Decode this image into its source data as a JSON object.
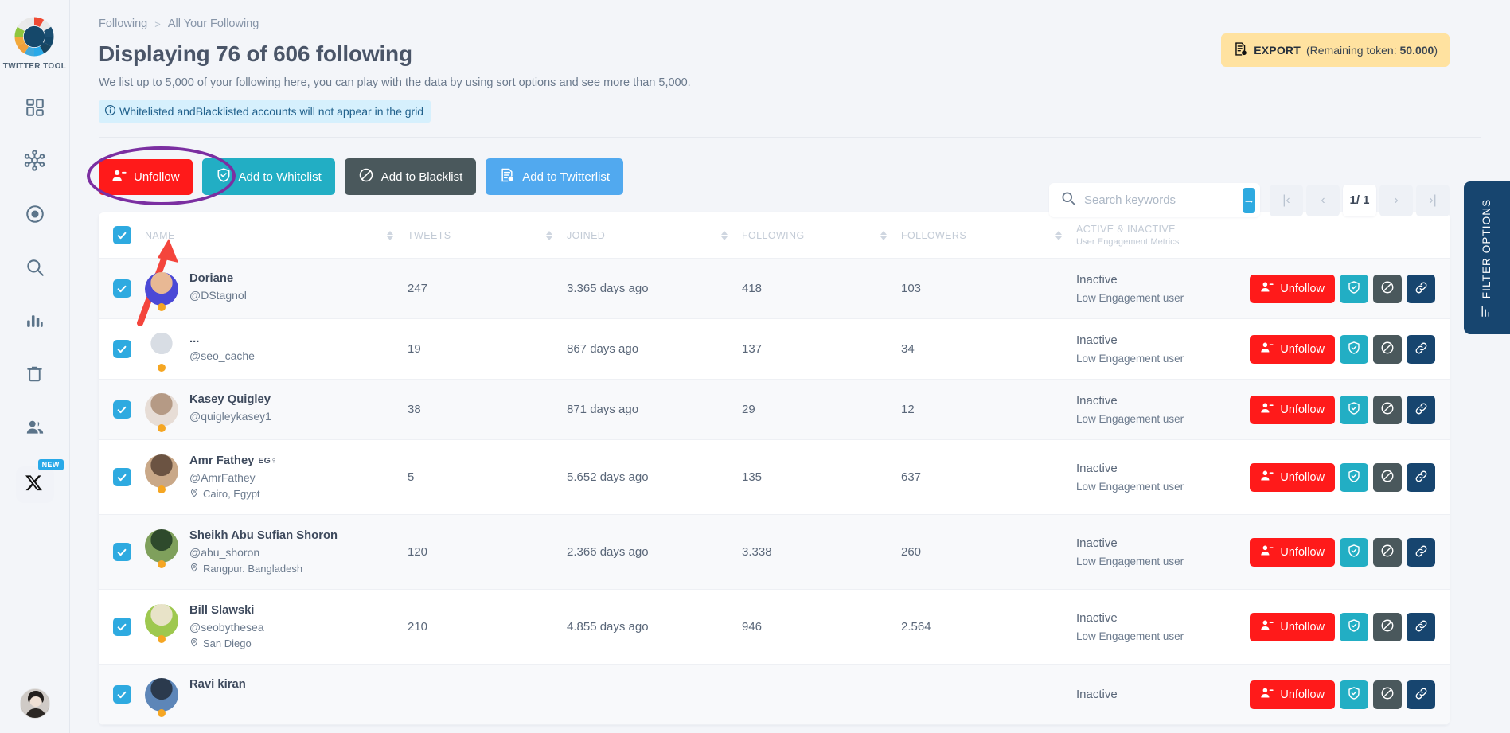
{
  "sidebar": {
    "brand": "TWITTER TOOL",
    "items": [
      {
        "name": "dashboard",
        "icon": "dashboard-icon"
      },
      {
        "name": "network",
        "icon": "network-icon"
      },
      {
        "name": "target",
        "icon": "target-icon"
      },
      {
        "name": "search",
        "icon": "search-icon"
      },
      {
        "name": "analytics",
        "icon": "analytics-icon"
      },
      {
        "name": "trash",
        "icon": "trash-icon"
      },
      {
        "name": "users",
        "icon": "users-icon"
      },
      {
        "name": "x",
        "icon": "x-icon",
        "badge": "NEW"
      }
    ]
  },
  "breadcrumb": {
    "root": "Following",
    "sep": ">",
    "current": "All Your Following"
  },
  "header": {
    "title": "Displaying 76 of 606 following",
    "subtitle": "We list up to 5,000 of your following here, you can play with the data by using sort options and see more than 5,000.",
    "info_banner": "Whitelisted andBlacklisted accounts will not appear in the grid"
  },
  "export": {
    "label": "EXPORT",
    "remaining_prefix": "(Remaining token: ",
    "remaining_value": "50.000",
    "remaining_suffix": ")"
  },
  "actions": {
    "unfollow": "Unfollow",
    "whitelist": "Add to Whitelist",
    "blacklist": "Add to Blacklist",
    "twitterlist": "Add to Twitterlist"
  },
  "search": {
    "placeholder": "Search keywords",
    "value": "",
    "go": "→"
  },
  "pagination": {
    "first": "|‹",
    "prev": "‹",
    "current": "1/ 1",
    "next": "›",
    "last": "›|"
  },
  "filter_tab": {
    "label": "FILTER OPTIONS"
  },
  "table": {
    "columns": [
      {
        "key": "name",
        "label": "NAME",
        "sortable": true
      },
      {
        "key": "tweets",
        "label": "TWEETS",
        "sortable": true
      },
      {
        "key": "joined",
        "label": "JOINED",
        "sortable": true
      },
      {
        "key": "following",
        "label": "FOLLOWING",
        "sortable": true
      },
      {
        "key": "followers",
        "label": "FOLLOWERS",
        "sortable": true
      },
      {
        "key": "active",
        "label": "ACTIVE & INACTIVE",
        "sublabel": "User Engagement Metrics",
        "sortable": false
      }
    ],
    "row_actions": {
      "unfollow": "Unfollow",
      "whitelist_icon": "shield-check-icon",
      "blacklist_icon": "block-icon",
      "link_icon": "link-icon"
    },
    "rows": [
      {
        "name": "Doriane",
        "handle": "@DStagnol",
        "location": "",
        "flag": "",
        "tweets": "247",
        "joined": "3.365 days ago",
        "following": "418",
        "followers": "103",
        "active": "Inactive",
        "engagement": "Low Engagement user",
        "checked": true,
        "avatar_colors": [
          "#4b49d6",
          "#e8b894"
        ]
      },
      {
        "name": "...",
        "handle": "@seo_cache",
        "location": "",
        "flag": "",
        "tweets": "19",
        "joined": "867 days ago",
        "following": "137",
        "followers": "34",
        "active": "Inactive",
        "engagement": "Low Engagement user",
        "checked": true,
        "avatar_colors": [
          "#ffffff",
          "#d8dde4"
        ]
      },
      {
        "name": "Kasey Quigley",
        "handle": "@quigleykasey1",
        "location": "",
        "flag": "",
        "tweets": "38",
        "joined": "871 days ago",
        "following": "29",
        "followers": "12",
        "active": "Inactive",
        "engagement": "Low Engagement user",
        "checked": true,
        "avatar_colors": [
          "#e7ddd6",
          "#b59a85"
        ]
      },
      {
        "name": "Amr Fathey",
        "handle": "@AmrFathey",
        "location": "Cairo, Egypt",
        "flag": "EG♀",
        "tweets": "5",
        "joined": "5.652 days ago",
        "following": "135",
        "followers": "637",
        "active": "Inactive",
        "engagement": "Low Engagement user",
        "checked": true,
        "avatar_colors": [
          "#c9a888",
          "#6b5342"
        ]
      },
      {
        "name": "Sheikh Abu Sufian Shoron",
        "handle": "@abu_shoron",
        "location": "Rangpur. Bangladesh",
        "flag": "",
        "tweets": "120",
        "joined": "2.366 days ago",
        "following": "3.338",
        "followers": "260",
        "active": "Inactive",
        "engagement": "Low Engagement user",
        "checked": true,
        "avatar_colors": [
          "#7fa05c",
          "#2e4a2c"
        ]
      },
      {
        "name": "Bill Slawski",
        "handle": "@seobythesea",
        "location": "San Diego",
        "flag": "",
        "tweets": "210",
        "joined": "4.855 days ago",
        "following": "946",
        "followers": "2.564",
        "active": "Inactive",
        "engagement": "Low Engagement user",
        "checked": true,
        "avatar_colors": [
          "#9ec84f",
          "#e8e3c8"
        ]
      },
      {
        "name": "Ravi kiran",
        "handle": "",
        "location": "",
        "flag": "",
        "tweets": "",
        "joined": "",
        "following": "",
        "followers": "",
        "active": "Inactive",
        "engagement": "",
        "checked": true,
        "avatar_colors": [
          "#5d86b8",
          "#2b3a4d"
        ]
      }
    ]
  },
  "colors": {
    "red": "#ff1a1a",
    "teal": "#22aec4",
    "dark": "#4a585c",
    "blue": "#51a9ef",
    "navy": "#17456f",
    "accent": "#2eaae0",
    "yellow": "#ffe2a0",
    "annotation_purple": "#7b2fa1",
    "annotation_red": "#f4453c"
  }
}
